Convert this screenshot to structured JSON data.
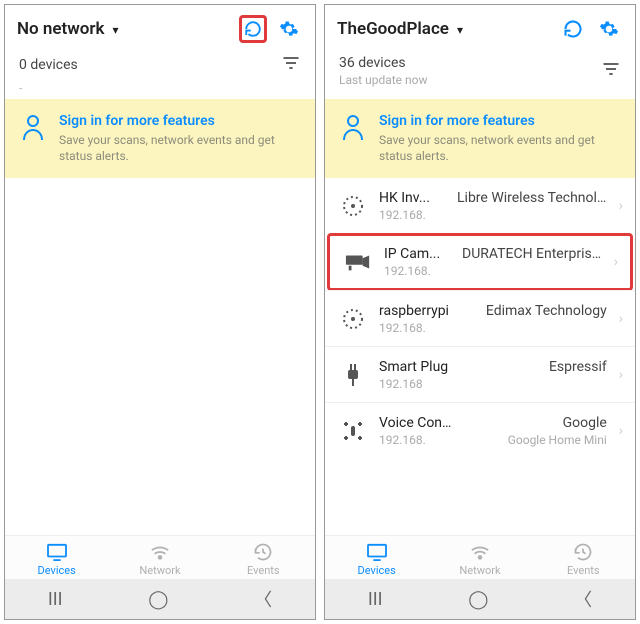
{
  "left": {
    "header": {
      "title": "No network"
    },
    "device_count": "0 devices",
    "signin": {
      "title": "Sign in for more features",
      "subtitle": "Save your scans, network events and get status alerts."
    },
    "nav": {
      "devices": "Devices",
      "network": "Network",
      "events": "Events"
    }
  },
  "right": {
    "header": {
      "title": "TheGoodPlace"
    },
    "device_count": "36 devices",
    "last_update": "Last update now",
    "signin": {
      "title": "Sign in for more features",
      "subtitle": "Save your scans, network events and get status alerts."
    },
    "devices": [
      {
        "name": "HK Inv...",
        "vendor": "Libre Wireless Technologies",
        "ip": "192.168.",
        "meta": "",
        "icon": "generic",
        "highlighted": false
      },
      {
        "name": "IP Cam...",
        "vendor": "DURATECH Enterprise,LLC",
        "ip": "192.168.",
        "meta": "",
        "icon": "camera",
        "highlighted": true
      },
      {
        "name": "raspberrypi",
        "vendor": "Edimax Technology",
        "ip": "192.168.",
        "meta": "",
        "icon": "generic",
        "highlighted": false
      },
      {
        "name": "Smart Plug",
        "vendor": "Espressif",
        "ip": "192.168",
        "meta": "",
        "icon": "plug",
        "highlighted": false
      },
      {
        "name": "Voice Control",
        "vendor": "Google",
        "ip": "192.168.",
        "meta": "Google Home Mini",
        "icon": "voice",
        "highlighted": false
      }
    ],
    "nav": {
      "devices": "Devices",
      "network": "Network",
      "events": "Events"
    }
  }
}
